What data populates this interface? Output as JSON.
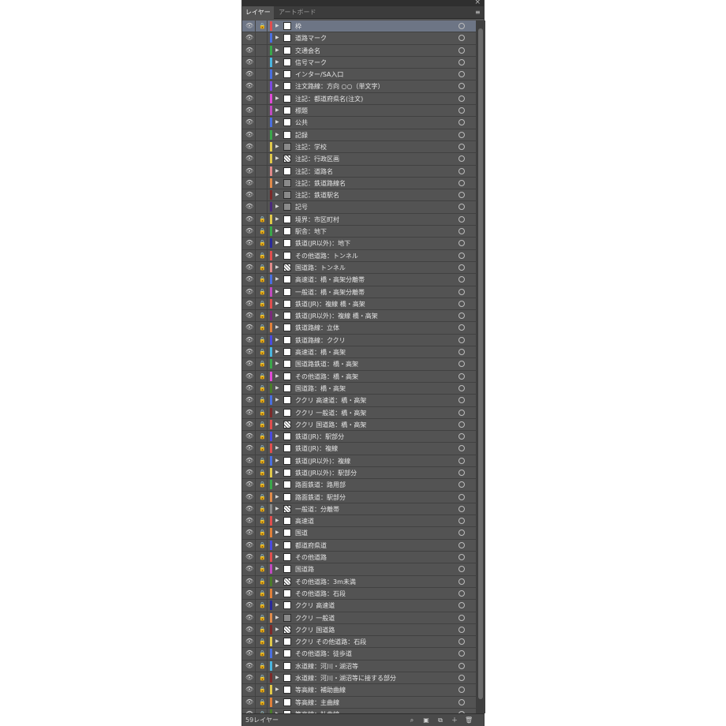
{
  "tabs": [
    {
      "label": "レイヤー",
      "active": true
    },
    {
      "label": "アートボード",
      "active": false
    }
  ],
  "icons": {
    "close": "×",
    "panel_menu": "≡",
    "eye": "👁",
    "lock": "🔒",
    "expand_arrow": "▶",
    "target": "○"
  },
  "layers": [
    {
      "name": "枠",
      "color": "#e04e4e",
      "locked": true,
      "selected": true
    },
    {
      "name": "道路マーク",
      "color": "#4a6fe0",
      "locked": false
    },
    {
      "name": "交通会名",
      "color": "#3aa74a",
      "locked": false
    },
    {
      "name": "信号マーク",
      "color": "#4ab6e0",
      "locked": false
    },
    {
      "name": "インター/SA入口",
      "color": "#4a6fe0",
      "locked": false
    },
    {
      "name": "注文路線：方向 ○○（単文字）",
      "color": "#7b4ae0",
      "locked": false
    },
    {
      "name": "注記：都道府県名(注文)",
      "color": "#e04ad6",
      "locked": false
    },
    {
      "name": "標題",
      "color": "#c04ac0",
      "locked": false
    },
    {
      "name": "公共",
      "color": "#4a6fe0",
      "locked": false
    },
    {
      "name": "記録",
      "color": "#3aa74a",
      "locked": false
    },
    {
      "name": "注記：学校",
      "color": "#e0c84a",
      "locked": false,
      "thumb": "gray"
    },
    {
      "name": "注記：行政区画",
      "color": "#e0c84a",
      "locked": false,
      "thumb": "pat"
    },
    {
      "name": "注記：道路名",
      "color": "#e08a8a",
      "locked": false
    },
    {
      "name": "注記：鉄道路線名",
      "color": "#e08a4a",
      "locked": false,
      "thumb": "gray"
    },
    {
      "name": "注記：鉄道駅名",
      "color": "#7b2a2a",
      "locked": false,
      "thumb": "gray"
    },
    {
      "name": "記号",
      "color": "#4a2a7b",
      "locked": false,
      "thumb": "gray"
    },
    {
      "name": "境界：市区町村",
      "color": "#e0c84a",
      "locked": true
    },
    {
      "name": "駅舎：地下",
      "color": "#3aa74a",
      "locked": true
    },
    {
      "name": "鉄道(JR以外)：地下",
      "color": "#2a2a9a",
      "locked": true
    },
    {
      "name": "その他道路：トンネル",
      "color": "#e04e4e",
      "locked": true
    },
    {
      "name": "国道路：トンネル",
      "color": "#e08a8a",
      "locked": true,
      "thumb": "pat"
    },
    {
      "name": "高速道：橋・高架分離帯",
      "color": "#4a6fe0",
      "locked": true
    },
    {
      "name": "一般道：橋・高架分離帯",
      "color": "#c04ac0",
      "locked": true
    },
    {
      "name": "鉄道(JR)：複線 橋・高架",
      "color": "#e04e4e",
      "locked": true
    },
    {
      "name": "鉄道(JR以外)：複線 橋・高架",
      "color": "#7b2a7b",
      "locked": true
    },
    {
      "name": "鉄道路線：立体",
      "color": "#e0803a",
      "locked": true
    },
    {
      "name": "鉄道路線：ククリ",
      "color": "#4a4ae0",
      "locked": true
    },
    {
      "name": "高速道：橋・高架",
      "color": "#4ab6e0",
      "locked": true
    },
    {
      "name": "国道路鉄道：橋・高架",
      "color": "#3aa74a",
      "locked": true
    },
    {
      "name": "その他道路：橋・高架",
      "color": "#e04ad6",
      "locked": true
    },
    {
      "name": "国道路：橋・高架",
      "color": "#4a7b2a",
      "locked": true
    },
    {
      "name": "ククリ 高速道：橋・高架",
      "color": "#4a6fe0",
      "locked": true
    },
    {
      "name": "ククリ 一般道：橋・高架",
      "color": "#7b2a2a",
      "locked": true
    },
    {
      "name": "ククリ 国道路：橋・高架",
      "color": "#e04e4e",
      "locked": true,
      "thumb": "pat"
    },
    {
      "name": "鉄道(JR)：駅部分",
      "color": "#4a4ae0",
      "locked": true
    },
    {
      "name": "鉄道(JR)：複線",
      "color": "#e04e4e",
      "locked": true
    },
    {
      "name": "鉄道(JR以外)：複線",
      "color": "#4a6fe0",
      "locked": true
    },
    {
      "name": "鉄道(JR以外)：駅部分",
      "color": "#e0c84a",
      "locked": true
    },
    {
      "name": "路面鉄道：路用部",
      "color": "#3aa74a",
      "locked": true
    },
    {
      "name": "路面鉄道：駅部分",
      "color": "#e08a4a",
      "locked": true
    },
    {
      "name": "一般道：分離帯",
      "color": "#8a8a8a",
      "locked": true,
      "thumb": "pat"
    },
    {
      "name": "高速道",
      "color": "#e04e4e",
      "locked": true
    },
    {
      "name": "国道",
      "color": "#e0803a",
      "locked": true
    },
    {
      "name": "都道府県道",
      "color": "#4a4ae0",
      "locked": true
    },
    {
      "name": "その他道路",
      "color": "#e04e4e",
      "locked": true
    },
    {
      "name": "国道路",
      "color": "#c04ac0",
      "locked": true
    },
    {
      "name": "その他道路：3m未満",
      "color": "#4a7b2a",
      "locked": true,
      "thumb": "pat"
    },
    {
      "name": "その他道路：石段",
      "color": "#e0803a",
      "locked": true
    },
    {
      "name": "ククリ 高速道",
      "color": "#2a2a9a",
      "locked": true
    },
    {
      "name": "ククリ 一般道",
      "color": "#e08a4a",
      "locked": true,
      "thumb": "gray"
    },
    {
      "name": "ククリ 国道路",
      "color": "#7b2a2a",
      "locked": true,
      "thumb": "pat"
    },
    {
      "name": "ククリ その他道路：石段",
      "color": "#e0c84a",
      "locked": true
    },
    {
      "name": "その他道路：徒歩道",
      "color": "#4a6fe0",
      "locked": true
    },
    {
      "name": "水道線：河川・湖沼等",
      "color": "#4ab6e0",
      "locked": true
    },
    {
      "name": "水道線：河川・湖沼等に接する部分",
      "color": "#7b2a2a",
      "locked": true
    },
    {
      "name": "等高線：補助曲線",
      "color": "#e0c84a",
      "locked": true
    },
    {
      "name": "等高線：主曲線",
      "color": "#e0803a",
      "locked": true
    },
    {
      "name": "等高線：計曲線",
      "color": "#4a7b2a",
      "locked": true
    }
  ],
  "footer": {
    "count_label": "59レイヤー"
  }
}
